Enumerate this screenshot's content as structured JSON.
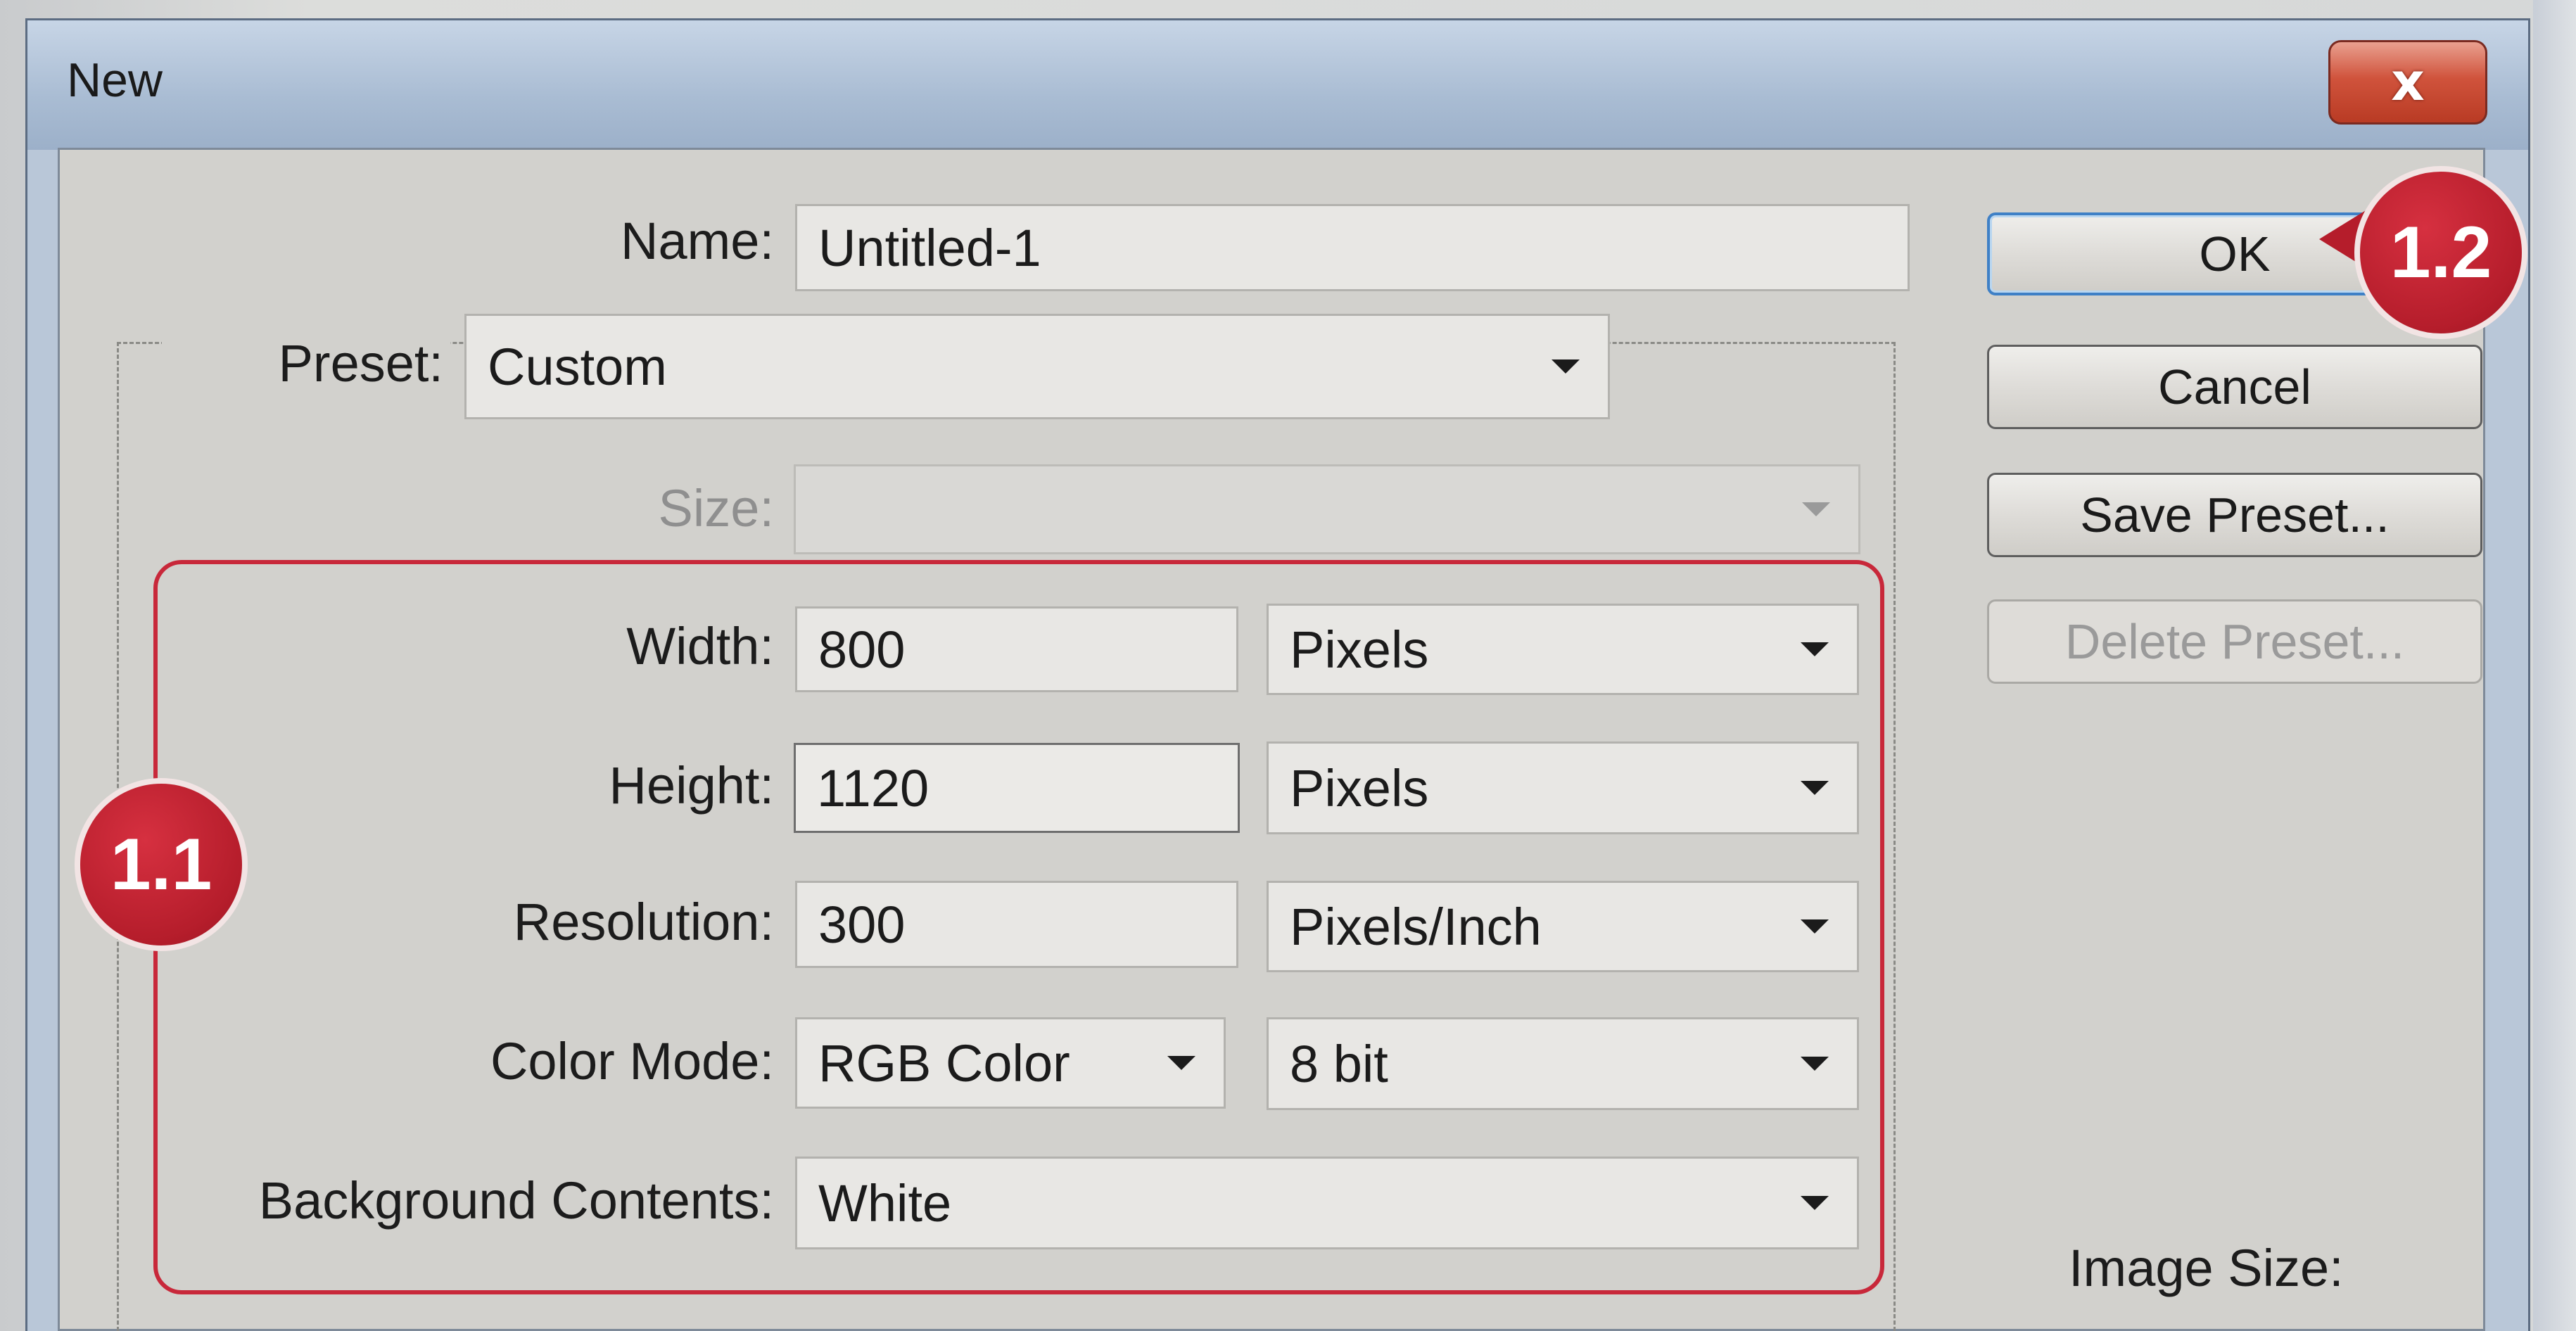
{
  "window": {
    "title": "New",
    "close_glyph": "x",
    "close_icon": "close-icon"
  },
  "form": {
    "name_label": "Name:",
    "name_value": "Untitled-1",
    "preset_label": "Preset:",
    "preset_value": "Custom",
    "size_label": "Size:",
    "size_value": "",
    "width_label": "Width:",
    "width_value": "800",
    "width_unit": "Pixels",
    "height_label": "Height:",
    "height_value": "1120",
    "height_unit": "Pixels",
    "resolution_label": "Resolution:",
    "resolution_value": "300",
    "resolution_unit": "Pixels/Inch",
    "color_mode_label": "Color Mode:",
    "color_mode_value": "RGB Color",
    "bit_depth_value": "8 bit",
    "background_label": "Background Contents:",
    "background_value": "White"
  },
  "buttons": {
    "ok": "OK",
    "cancel": "Cancel",
    "save_preset": "Save Preset...",
    "delete_preset": "Delete Preset..."
  },
  "info": {
    "image_size_label": "Image Size:"
  },
  "annotations": {
    "badge_1": "1.1",
    "badge_2": "1.2"
  },
  "colors": {
    "accent_red": "#c8283a",
    "default_button_border": "#3f80c6",
    "dialog_background": "#d2d1cd"
  }
}
